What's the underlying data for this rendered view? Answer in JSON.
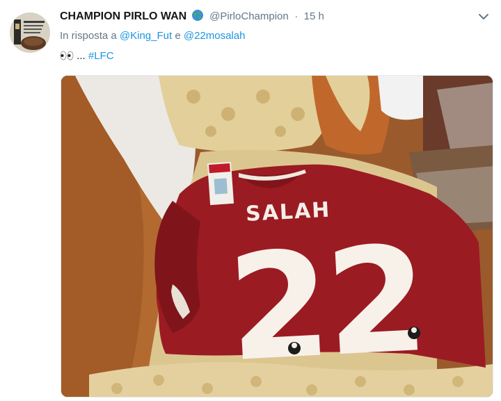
{
  "tweet": {
    "display_name": "CHAMPION PIRLO WAN",
    "handle": "@PirloChampion",
    "separator": "·",
    "time": "15 h",
    "reply_prefix": "In risposta a",
    "reply_user_1": "@King_Fut",
    "reply_and": "e",
    "reply_user_2": "@22mosalah",
    "text_ellipsis": "...",
    "hashtag": "#LFC"
  },
  "media": {
    "shirt_name": "SALAH",
    "shirt_number": "22",
    "description_icon": "jersey-photo"
  },
  "colors": {
    "link": "#1b95e0",
    "muted": "#657786",
    "jersey": "#9b1b22"
  },
  "icons": [
    "globe-icon",
    "chevron-down-icon",
    "eyes-icon"
  ]
}
